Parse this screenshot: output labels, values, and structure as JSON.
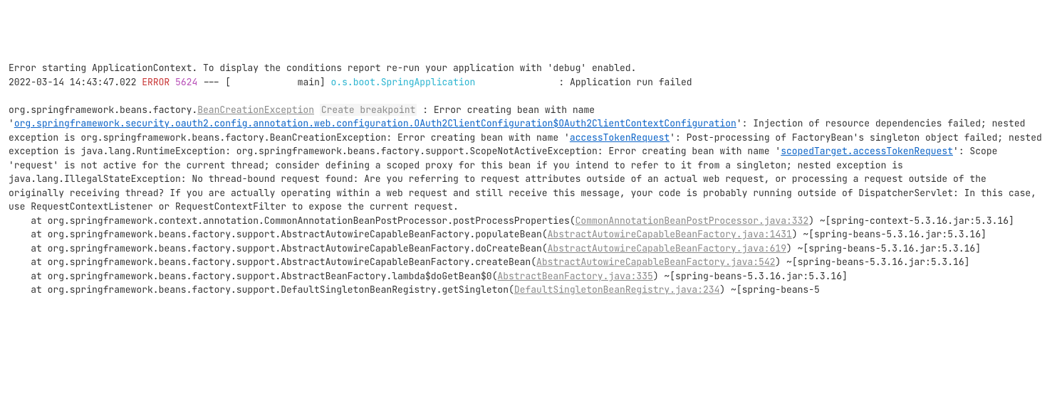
{
  "header": {
    "line1": "Error starting ApplicationContext. To display the conditions report re-run your application with 'debug' enabled.",
    "timestamp": "2022-03-14 14:43:47.022",
    "level": "ERROR",
    "pid": "5624",
    "dashes": "---",
    "thread": "[            main]",
    "logger": "o.s.boot.SpringApplication",
    "loggerPad": "               ",
    "colon": ": ",
    "message": "Application run failed"
  },
  "exception": {
    "prefix1": "org.springframework.beans.factory.",
    "excName": "BeanCreationException",
    "createBp": "Create breakpoint",
    "txt1": " : Error creating bean with name '",
    "link1": "org.springframework.security.oauth2.config.annotation.web.configuration.OAuth2ClientConfiguration$OAuth2ClientContextConfiguration",
    "txt2": "': Injection of resource dependencies failed; nested exception is org.springframework.beans.factory.BeanCreationException: Error creating bean with name '",
    "link2": "accessTokenRequest",
    "txt3": "': Post-processing of FactoryBean's singleton object failed; nested exception is java.lang.RuntimeException: org.springframework.beans.factory.support.ScopeNotActiveException: Error creating bean with name '",
    "link3": "scopedTarget.accessTokenRequest",
    "txt4": "': Scope 'request' is not active for the current thread; consider defining a scoped proxy for this bean if you intend to refer to it from a singleton; nested exception is java.lang.IllegalStateException: No thread-bound request found: Are you referring to request attributes outside of an actual web request, or processing a request outside of the originally receiving thread? If you are actually operating within a web request and still receive this message, your code is probably running outside of DispatcherServlet: In this case, use RequestContextListener or RequestContextFilter to expose the current request."
  },
  "stack": [
    {
      "at": "    at org.springframework.context.annotation.CommonAnnotationBeanPostProcessor.postProcessProperties(",
      "file": "CommonAnnotationBeanPostProcessor.java:332",
      "tail": ") ~[spring-context-5.3.16.jar:5.3.16]"
    },
    {
      "at": "    at org.springframework.beans.factory.support.AbstractAutowireCapableBeanFactory.populateBean(",
      "file": "AbstractAutowireCapableBeanFactory.java:1431",
      "tail": ") ~[spring-beans-5.3.16.jar:5.3.16]"
    },
    {
      "at": "    at org.springframework.beans.factory.support.AbstractAutowireCapableBeanFactory.doCreateBean(",
      "file": "AbstractAutowireCapableBeanFactory.java:619",
      "tail": ") ~[spring-beans-5.3.16.jar:5.3.16]"
    },
    {
      "at": "    at org.springframework.beans.factory.support.AbstractAutowireCapableBeanFactory.createBean(",
      "file": "AbstractAutowireCapableBeanFactory.java:542",
      "tail": ") ~[spring-beans-5.3.16.jar:5.3.16]"
    },
    {
      "at": "    at org.springframework.beans.factory.support.AbstractBeanFactory.lambda$doGetBean$0(",
      "file": "AbstractBeanFactory.java:335",
      "tail": ") ~[spring-beans-5.3.16.jar:5.3.16]"
    },
    {
      "at": "    at org.springframework.beans.factory.support.DefaultSingletonBeanRegistry.getSingleton(",
      "file": "DefaultSingletonBeanRegistry.java:234",
      "tail": ") ~[spring-beans-5"
    }
  ]
}
